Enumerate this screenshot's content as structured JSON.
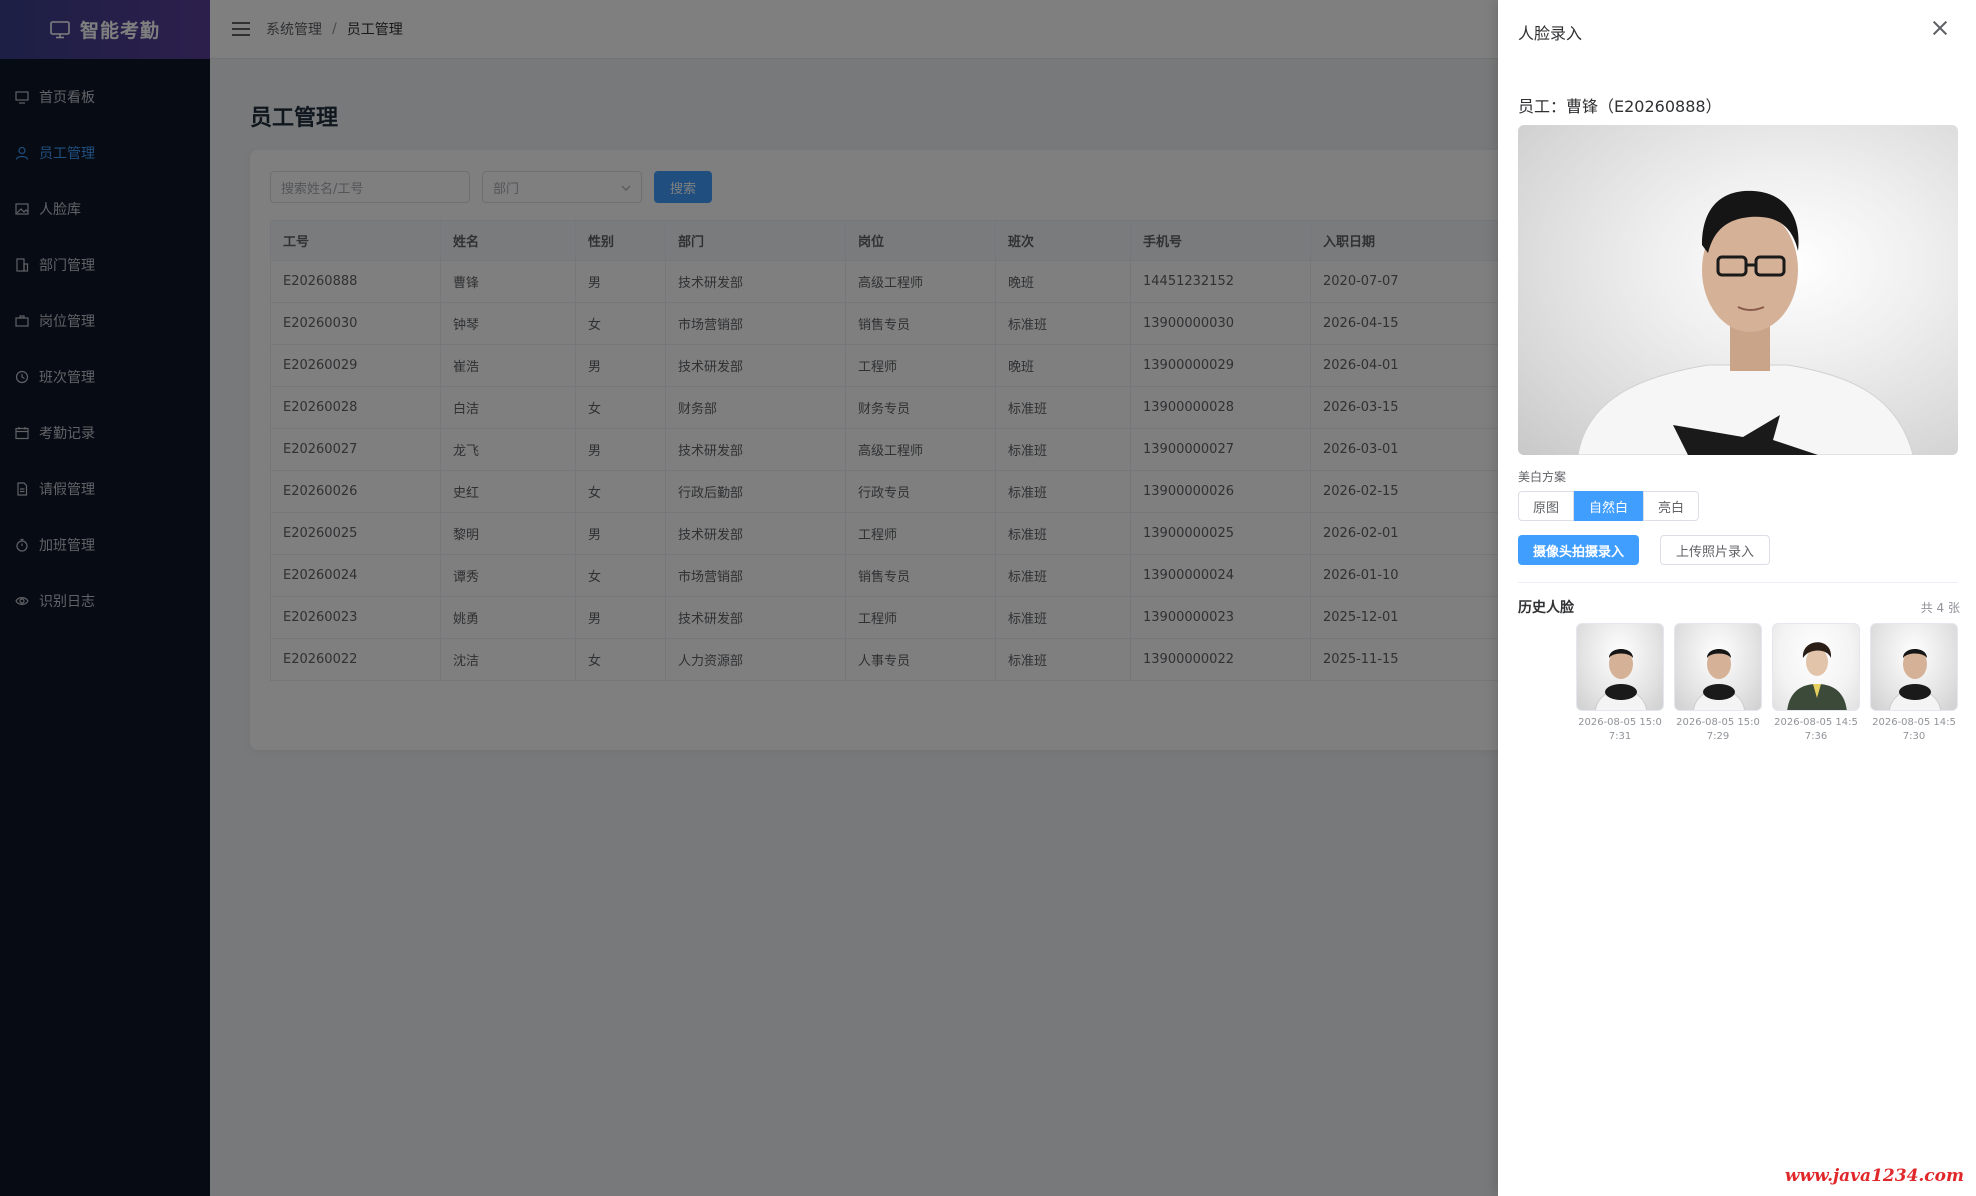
{
  "app": {
    "title": "智能考勤"
  },
  "sidebar": {
    "items": [
      {
        "label": "首页看板",
        "icon": "dashboard-icon"
      },
      {
        "label": "员工管理",
        "icon": "user-icon",
        "active": true
      },
      {
        "label": "人脸库",
        "icon": "image-icon"
      },
      {
        "label": "部门管理",
        "icon": "building-icon"
      },
      {
        "label": "岗位管理",
        "icon": "briefcase-icon"
      },
      {
        "label": "班次管理",
        "icon": "clock-icon"
      },
      {
        "label": "考勤记录",
        "icon": "calendar-icon"
      },
      {
        "label": "请假管理",
        "icon": "document-icon"
      },
      {
        "label": "加班管理",
        "icon": "timer-icon"
      },
      {
        "label": "识别日志",
        "icon": "eye-icon"
      }
    ]
  },
  "header": {
    "breadcrumb": [
      "系统管理",
      "员工管理"
    ],
    "sep": "/"
  },
  "main": {
    "title": "员工管理",
    "search": {
      "placeholder": "搜索姓名/工号",
      "dept_placeholder": "部门",
      "button": "搜索"
    },
    "table": {
      "columns": [
        "工号",
        "姓名",
        "性别",
        "部门",
        "岗位",
        "班次",
        "手机号",
        "入职日期"
      ],
      "rows": [
        [
          "E20260888",
          "曹锋",
          "男",
          "技术研发部",
          "高级工程师",
          "晚班",
          "14451232152",
          "2020-07-07"
        ],
        [
          "E20260030",
          "钟琴",
          "女",
          "市场营销部",
          "销售专员",
          "标准班",
          "13900000030",
          "2026-04-15"
        ],
        [
          "E20260029",
          "崔浩",
          "男",
          "技术研发部",
          "工程师",
          "晚班",
          "13900000029",
          "2026-04-01"
        ],
        [
          "E20260028",
          "白洁",
          "女",
          "财务部",
          "财务专员",
          "标准班",
          "13900000028",
          "2026-03-15"
        ],
        [
          "E20260027",
          "龙飞",
          "男",
          "技术研发部",
          "高级工程师",
          "标准班",
          "13900000027",
          "2026-03-01"
        ],
        [
          "E20260026",
          "史红",
          "女",
          "行政后勤部",
          "行政专员",
          "标准班",
          "13900000026",
          "2026-02-15"
        ],
        [
          "E20260025",
          "黎明",
          "男",
          "技术研发部",
          "工程师",
          "标准班",
          "13900000025",
          "2026-02-01"
        ],
        [
          "E20260024",
          "谭秀",
          "女",
          "市场营销部",
          "销售专员",
          "标准班",
          "13900000024",
          "2026-01-10"
        ],
        [
          "E20260023",
          "姚勇",
          "男",
          "技术研发部",
          "工程师",
          "标准班",
          "13900000023",
          "2025-12-01"
        ],
        [
          "E20260022",
          "沈洁",
          "女",
          "人力资源部",
          "人事专员",
          "标准班",
          "13900000022",
          "2025-11-15"
        ]
      ]
    }
  },
  "drawer": {
    "title": "人脸录入",
    "employee": "员工：曹锋（E20260888）",
    "beauty_label": "美白方案",
    "beauty_options": [
      "原图",
      "自然白",
      "亮白"
    ],
    "beauty_selected": "自然白",
    "camera_button": "摄像头拍摄录入",
    "upload_button": "上传照片录入",
    "history_title": "历史人脸",
    "history_count": "共 4 张",
    "history": [
      {
        "time": "2026-08-05 15:07:31"
      },
      {
        "time": "2026-08-05 15:07:29"
      },
      {
        "time": "2026-08-05 14:57:36"
      },
      {
        "time": "2026-08-05 14:57:30"
      }
    ]
  },
  "watermark": "www.java1234.com",
  "colors": {
    "accent": "#409eff",
    "sidebar_bg": "#0f1626",
    "watermark": "#e0282a"
  }
}
